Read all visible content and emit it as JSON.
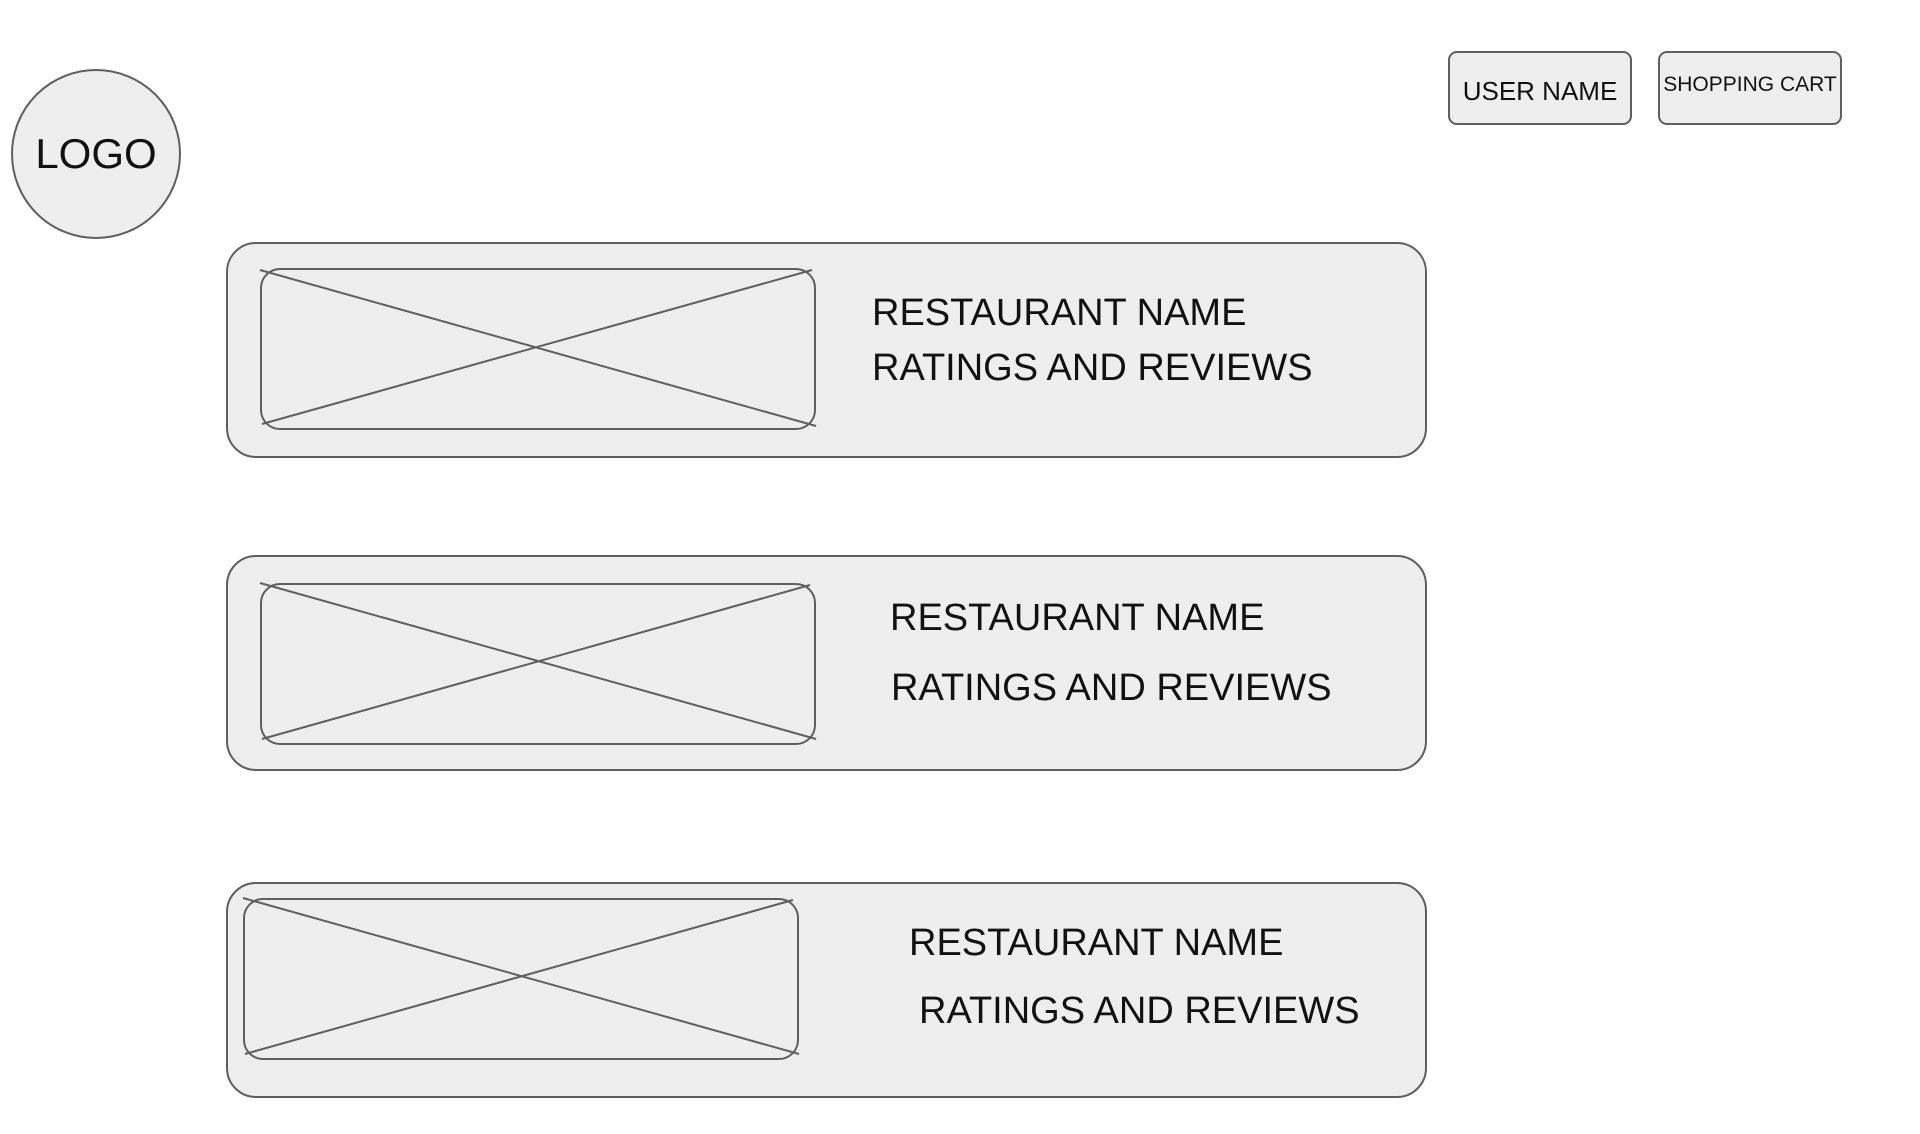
{
  "header": {
    "logo_label": "LOGO",
    "user_button_label": "USER NAME",
    "cart_button_label": "SHOPPING CART"
  },
  "restaurants": [
    {
      "name": "RESTAURANT NAME",
      "ratings": "RATINGS AND REVIEWS",
      "image_icon": "image-placeholder-icon"
    },
    {
      "name": "RESTAURANT NAME",
      "ratings": "RATINGS AND REVIEWS",
      "image_icon": "image-placeholder-icon"
    },
    {
      "name": "RESTAURANT NAME",
      "ratings": "RATINGS AND REVIEWS",
      "image_icon": "image-placeholder-icon"
    }
  ],
  "colors": {
    "fill": "#eeeeee",
    "stroke": "#5f5f5f",
    "text": "#111111",
    "background": "#ffffff"
  }
}
